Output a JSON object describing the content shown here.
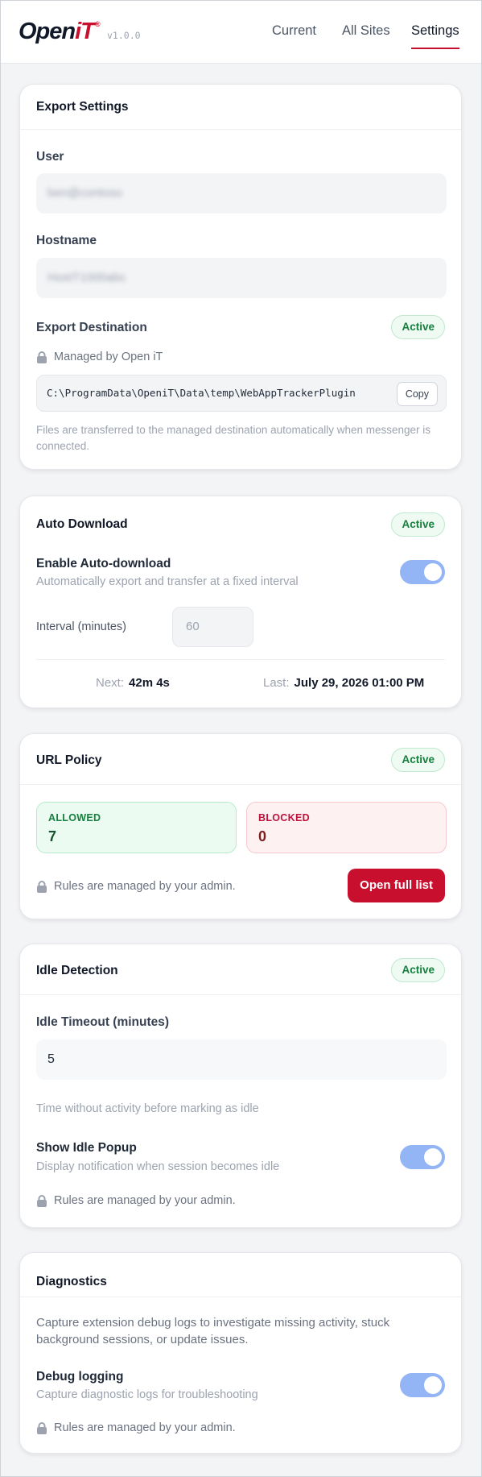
{
  "header": {
    "logo_open": "Open",
    "logo_it": "iT",
    "logo_reg": "®",
    "version": "v1.0.0",
    "tabs": [
      {
        "label": "Current"
      },
      {
        "label": "All Sites"
      },
      {
        "label": "Settings",
        "active": true
      }
    ]
  },
  "export_settings": {
    "title": "Export Settings",
    "user_label": "User",
    "user_value": "ben@contoso",
    "hostname_label": "Hostname",
    "hostname_value": "HostT1000abc",
    "destination_label": "Export Destination",
    "destination_badge": "Active",
    "managed_text": "Managed by Open iT",
    "path": "C:\\ProgramData\\OpeniT\\Data\\temp\\WebAppTrackerPlugin",
    "copy_label": "Copy",
    "note": "Files are transferred to the managed destination automatically when messenger is connected."
  },
  "auto_download": {
    "title": "Auto Download",
    "badge": "Active",
    "enable_label": "Enable Auto-download",
    "enable_desc": "Automatically export and transfer at a fixed interval",
    "enabled": true,
    "interval_label": "Interval (minutes)",
    "interval_value": "60",
    "next_label": "Next:",
    "next_value": "42m 4s",
    "last_label": "Last:",
    "last_value": "July 29, 2026 01:00 PM"
  },
  "url_policy": {
    "title": "URL Policy",
    "badge": "Active",
    "allowed_label": "ALLOWED",
    "allowed_count": "7",
    "blocked_label": "BLOCKED",
    "blocked_count": "0",
    "managed_text": "Rules are managed by your admin.",
    "open_button": "Open full list"
  },
  "idle_detection": {
    "title": "Idle Detection",
    "badge": "Active",
    "timeout_label": "Idle Timeout (minutes)",
    "timeout_value": "5",
    "timeout_desc": "Time without activity before marking as idle",
    "popup_label": "Show Idle Popup",
    "popup_desc": "Display notification when session becomes idle",
    "popup_enabled": true,
    "managed_text": "Rules are managed by your admin."
  },
  "diagnostics": {
    "title": "Diagnostics",
    "description": "Capture extension debug logs to investigate missing activity, stuck background sessions, or update issues.",
    "debug_label": "Debug logging",
    "debug_desc": "Capture diagnostic logs for troubleshooting",
    "debug_enabled": true,
    "managed_text": "Rules are managed by your admin."
  },
  "colors": {
    "brand": "#c8102e",
    "active_badge": "#15803d",
    "toggle_on": "#93b4f5"
  }
}
